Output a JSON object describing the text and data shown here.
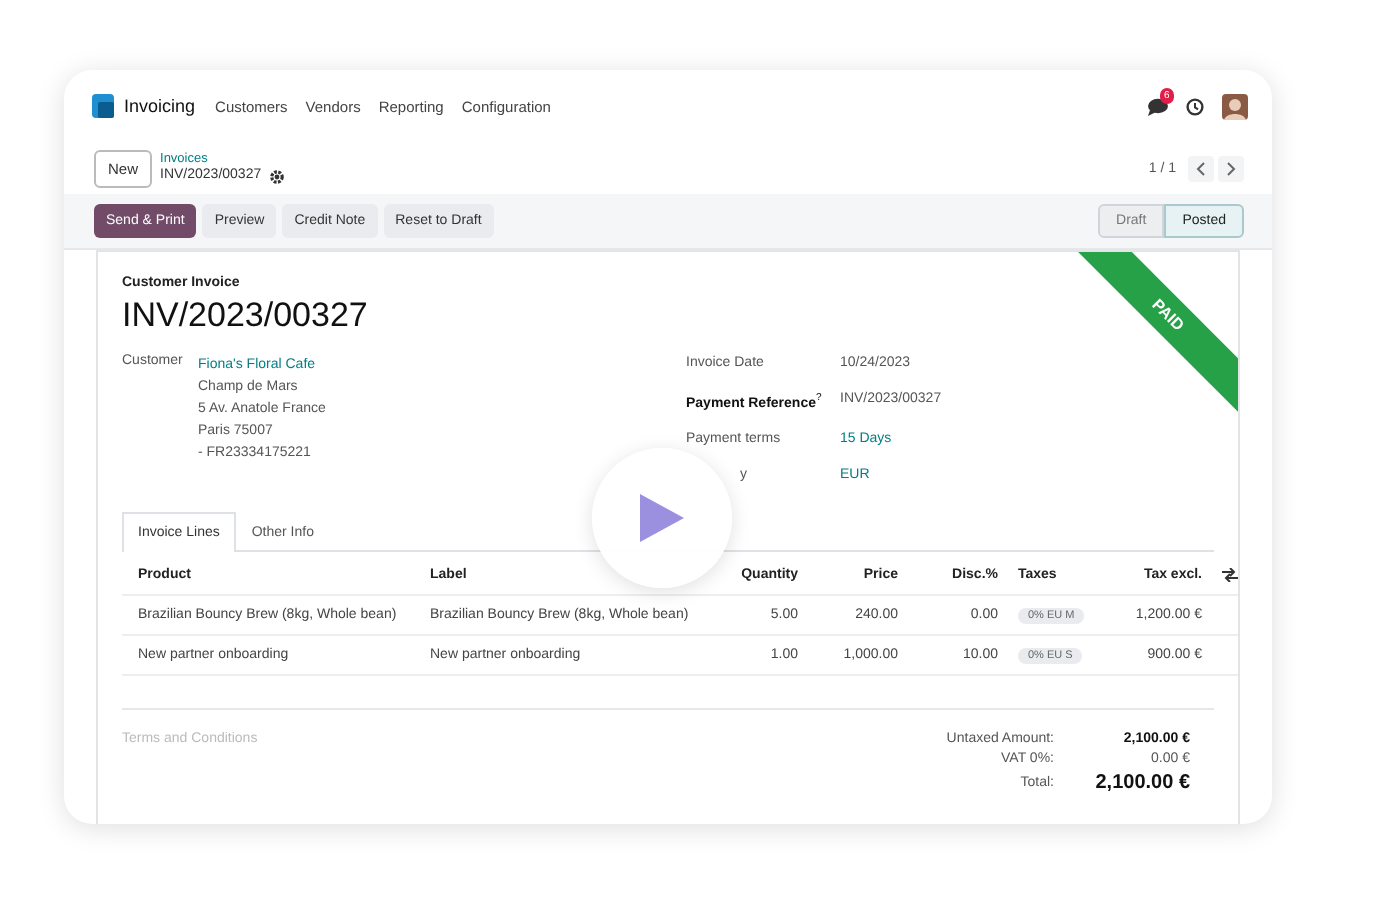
{
  "nav": {
    "app": "Invoicing",
    "menu": [
      "Customers",
      "Vendors",
      "Reporting",
      "Configuration"
    ],
    "message_count": "6"
  },
  "breadcrumb": {
    "new_button": "New",
    "parent": "Invoices",
    "current": "INV/2023/00327"
  },
  "pager": {
    "counter": "1 / 1"
  },
  "actions": [
    {
      "label": "Send & Print",
      "kind": "primary"
    },
    {
      "label": "Preview",
      "kind": "secondary"
    },
    {
      "label": "Credit Note",
      "kind": "secondary"
    },
    {
      "label": "Reset to Draft",
      "kind": "secondary"
    }
  ],
  "status": [
    {
      "label": "Draft",
      "selected": false
    },
    {
      "label": "Posted",
      "selected": true
    }
  ],
  "invoice": {
    "type": "Customer Invoice",
    "number": "INV/2023/00327",
    "ribbon": "PAID",
    "customer": {
      "label": "Customer",
      "name": "Fiona's Floral Cafe",
      "address": [
        "Champ de Mars",
        "5 Av. Anatole France",
        "Paris 75007",
        "- FR23334175221"
      ]
    },
    "fields": [
      {
        "kind": "plain",
        "label": "Invoice Date",
        "value": "10/24/2023",
        "emphasis": false,
        "link": false
      },
      {
        "kind": "plain",
        "label": "Payment Reference$^{?}$",
        "value": "INV/2023/00327",
        "emphasis": true,
        "link": false
      },
      {
        "kind": "plain",
        "label": "Payment terms",
        "value": "15 Days",
        "emphasis": false,
        "link": true
      },
      {
        "kind": "partly-covered",
        "label": "y",
        "value": "EUR",
        "emphasis": false,
        "link": true
      }
    ],
    "tabs": [
      {
        "label": "Invoice Lines",
        "selected": true
      },
      {
        "label": "Other Info",
        "selected": false
      }
    ],
    "table": {
      "columns": [
        "Product",
        "Label",
        "Quantity",
        "Price",
        "Disc.%",
        "Taxes",
        "Tax excl."
      ],
      "rows": [
        {
          "product": "Brazilian Bouncy Brew (8kg, Whole bean)",
          "label": "Brazilian Bouncy Brew (8kg, Whole bean)",
          "quantity": "5.00",
          "price": "240.00",
          "discount": "0.00",
          "taxes": "0% EU M",
          "amount": "1,200.00 €"
        },
        {
          "product": "New partner onboarding",
          "label": "New partner onboarding",
          "quantity": "1.00",
          "price": "1,000.00",
          "discount": "10.00",
          "taxes": "0% EU S",
          "amount": "900.00 €"
        }
      ]
    },
    "terms_placeholder": "Terms and Conditions",
    "totals": [
      {
        "label": "Untaxed Amount:",
        "value": "2,100.00 €",
        "kind": "subtotal"
      },
      {
        "label": "VAT 0%:",
        "value": "0.00 €",
        "kind": "tax"
      },
      {
        "label": "Total:",
        "value": "2,100.00 €",
        "kind": "total"
      }
    ]
  }
}
